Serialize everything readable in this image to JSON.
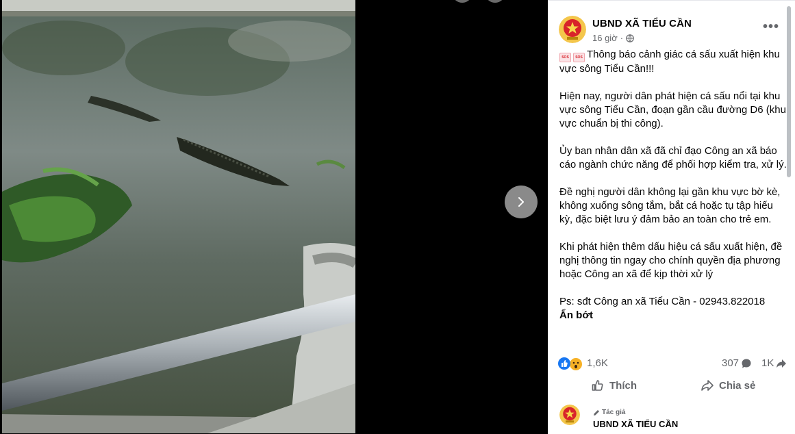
{
  "post": {
    "page_name": "UBND XÃ TIỂU CẦN",
    "time": "16 giờ",
    "privacy_icon": "globe-icon",
    "title_line": "Thông báo cảnh giác cá sấu xuất hiện khu vực sông Tiểu Cần!!!",
    "paragraph1": "Hiện nay, người dân phát hiện cá sấu nổi tại khu vực sông Tiểu Cần, đoạn gần cầu đường D6 (khu vực chuẩn bị thi công).",
    "paragraph2": "Ủy ban nhân dân xã đã chỉ đạo Công an xã báo cáo ngành chức năng để phối hợp kiểm tra, xử lý.",
    "paragraph3": "Đề nghị người dân không lại gần khu vực bờ kè, không xuống sông tắm, bắt cá hoặc tụ tập hiếu kỳ, đặc biệt lưu ý đảm bảo an toàn cho trẻ em.",
    "paragraph4": "Khi phát hiện thêm dấu hiệu cá sấu xuất hiện, đề nghị thông tin ngay cho chính quyền địa phương hoặc Công an xã để kịp thời xử lý",
    "ps_line": "Ps: sđt Công an xã Tiểu Cần - 02943.822018",
    "see_less": "Ẩn bớt"
  },
  "stats": {
    "reactions": "1,6K",
    "comments": "307",
    "shares": "1K"
  },
  "actions": {
    "like": "Thích",
    "share": "Chia sẻ"
  },
  "author": {
    "tag": "Tác giả",
    "name": "UBND XÃ TIỂU CẦN"
  },
  "colors": {
    "link_blue": "#1877f2",
    "secondary_text": "#65676b",
    "primary_text": "#050505"
  }
}
